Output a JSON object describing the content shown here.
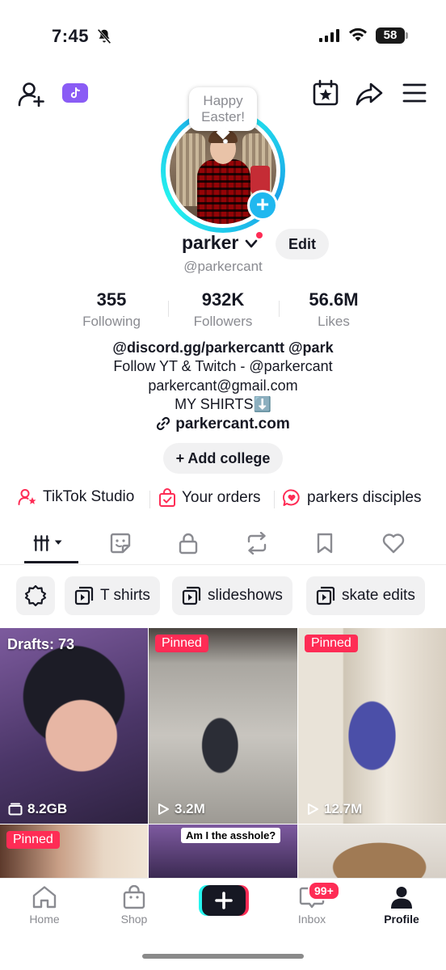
{
  "status_bar": {
    "time": "7:45",
    "battery": "58"
  },
  "bubble": {
    "line1": "Happy",
    "line2": "Easter!"
  },
  "profile": {
    "name": "parker",
    "edit_label": "Edit",
    "handle": "@parkercant"
  },
  "stats": [
    {
      "value": "355",
      "label": "Following"
    },
    {
      "value": "932K",
      "label": "Followers"
    },
    {
      "value": "56.6M",
      "label": "Likes"
    }
  ],
  "bio": {
    "line1": "@discord.gg/parkercantt @park",
    "line2": "Follow YT & Twitch - @parkercant",
    "line3": "parkercant@gmail.com",
    "line4": "MY SHIRTS⬇️",
    "link": "parkercant.com",
    "add_college": "Add college"
  },
  "quick_links": [
    {
      "label": "TikTok Studio",
      "icon": "person-star-icon"
    },
    {
      "label": "Your orders",
      "icon": "bag-check-icon"
    },
    {
      "label": "parkers disciples",
      "icon": "chat-heart-icon"
    }
  ],
  "tabs": [
    "grid-icon",
    "sticker-icon",
    "lock-icon",
    "repost-icon",
    "bookmark-icon",
    "heart-icon"
  ],
  "chips": [
    {
      "label": "T shirts"
    },
    {
      "label": "slideshows"
    },
    {
      "label": "skate edits"
    }
  ],
  "videos": [
    {
      "label": "Drafts: 73",
      "stat": "8.2GB",
      "type": "drafts"
    },
    {
      "label": "Pinned",
      "stat": "3.2M",
      "type": "pinned"
    },
    {
      "label": "Pinned",
      "stat": "12.7M",
      "type": "pinned"
    },
    {
      "label": "Pinned",
      "type": "pinned"
    },
    {
      "caption": "Am I the asshole?"
    },
    {}
  ],
  "bottom_nav": {
    "home": "Home",
    "shop": "Shop",
    "inbox": "Inbox",
    "inbox_badge": "99+",
    "profile": "Profile"
  },
  "colors": {
    "accent": "#fe2c55",
    "cyan": "#25f4ee",
    "badge_blue": "#20b8ef",
    "studio_purple": "#8a5cf5"
  }
}
